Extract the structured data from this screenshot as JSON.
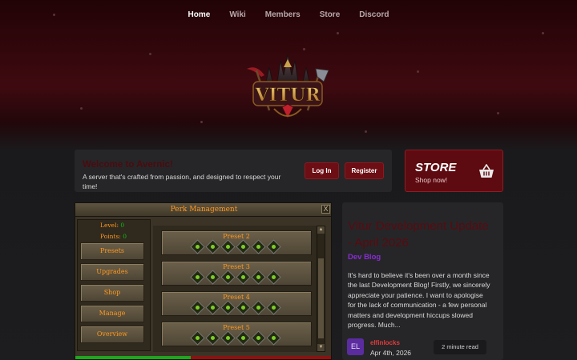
{
  "nav": {
    "items": [
      {
        "label": "Home",
        "active": true
      },
      {
        "label": "Wiki",
        "active": false
      },
      {
        "label": "Members",
        "active": false
      },
      {
        "label": "Store",
        "active": false
      },
      {
        "label": "Discord",
        "active": false
      }
    ]
  },
  "logo": {
    "text": "VITUR",
    "icon": "vitur-logo"
  },
  "welcome": {
    "title": "Welcome to Avernic!",
    "description": "A server that's crafted from passion, and designed to respect your time!",
    "login_label": "Log In",
    "register_label": "Register"
  },
  "store_card": {
    "title": "STORE",
    "subtitle": "Shop now!",
    "icon": "basket-icon"
  },
  "game_panel": {
    "title": "Perk Management",
    "close_label": "X",
    "level_label": "Level:",
    "level_value": "0",
    "points_label": "Points:",
    "points_value": "0",
    "menu": [
      "Presets",
      "Upgrades",
      "Shop",
      "Manage",
      "Overview"
    ],
    "presets": [
      "Preset 2",
      "Preset 3",
      "Preset 4",
      "Preset 5"
    ],
    "progress_fraction": 0.45
  },
  "blog": {
    "title": "Vitur Development Update - April 2026",
    "category": "Dev Blog",
    "excerpt": "It's hard to believe it's been over a month since the last Development Blog! Firstly, we sincerely appreciate your patience. I want to apologise for the lack of communication - a few personal matters and development hiccups slowed progress. Much...",
    "author_initials": "EL",
    "author": "elfinlocks",
    "date": "Apr 4th, 2026",
    "read_time": "2 minute read"
  },
  "colors": {
    "accent_red": "#6c0e14",
    "dev_blog_purple": "#8a2bd6",
    "game_orange": "#ff981f",
    "game_green": "#0dc10d"
  }
}
